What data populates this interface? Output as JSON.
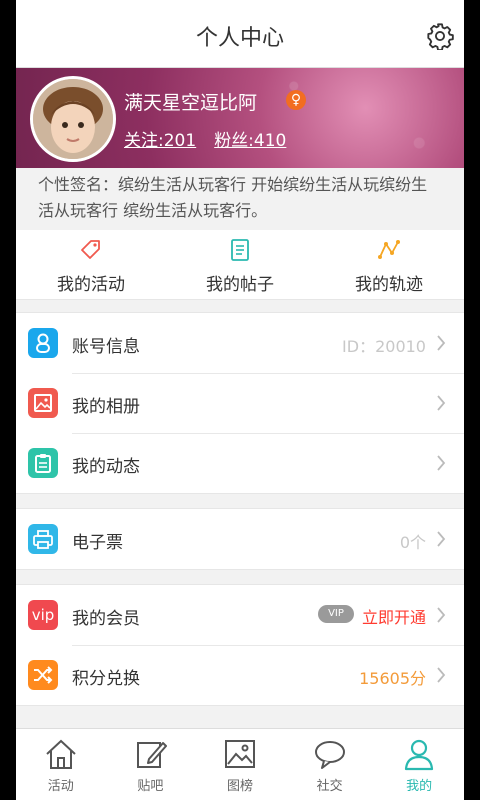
{
  "header": {
    "title": "个人中心",
    "settings_icon": "gear-icon"
  },
  "profile": {
    "username": "满天星空逗比阿",
    "gender_symbol": "♀",
    "gender_color": "#f26d21",
    "following": "关注:201",
    "followers": "粉丝:410",
    "signature": "个性签名：缤纷生活从玩客行 开始缤纷生活从玩缤纷生活从玩客行 缤纷生活从玩客行。"
  },
  "quick_tabs": [
    {
      "label": "我的活动",
      "icon": "tag-icon",
      "color": "#f05a4f"
    },
    {
      "label": "我的帖子",
      "icon": "document-icon",
      "color": "#2ab9b0"
    },
    {
      "label": "我的轨迹",
      "icon": "trajectory-icon",
      "color": "#f5a623"
    }
  ],
  "menu": {
    "account": {
      "label": "账号信息",
      "value": "ID：20010",
      "icon": "user-icon",
      "color": "#1aa7ec"
    },
    "album": {
      "label": "我的相册",
      "icon": "photo-icon",
      "color": "#f05a4f"
    },
    "moments": {
      "label": "我的动态",
      "icon": "clipboard-icon",
      "color": "#2ec4a9"
    },
    "ticket": {
      "label": "电子票",
      "value": "0个",
      "icon": "printer-icon",
      "color": "#30b7e8"
    },
    "vip": {
      "label": "我的会员",
      "icon_text": "vip",
      "badge": "VIP",
      "action": "立即开通",
      "color": "#f0494f"
    },
    "points": {
      "label": "积分兑换",
      "value": "15605分",
      "icon": "shuffle-icon",
      "color": "#ff8a1e",
      "value_color": "#f39b3a"
    }
  },
  "bottom_nav": [
    {
      "label": "活动",
      "icon": "home-icon"
    },
    {
      "label": "贴吧",
      "icon": "edit-icon"
    },
    {
      "label": "图榜",
      "icon": "image-icon"
    },
    {
      "label": "社交",
      "icon": "chat-icon"
    },
    {
      "label": "我的",
      "icon": "person-icon",
      "active": true,
      "color": "#2ab9b0"
    }
  ]
}
